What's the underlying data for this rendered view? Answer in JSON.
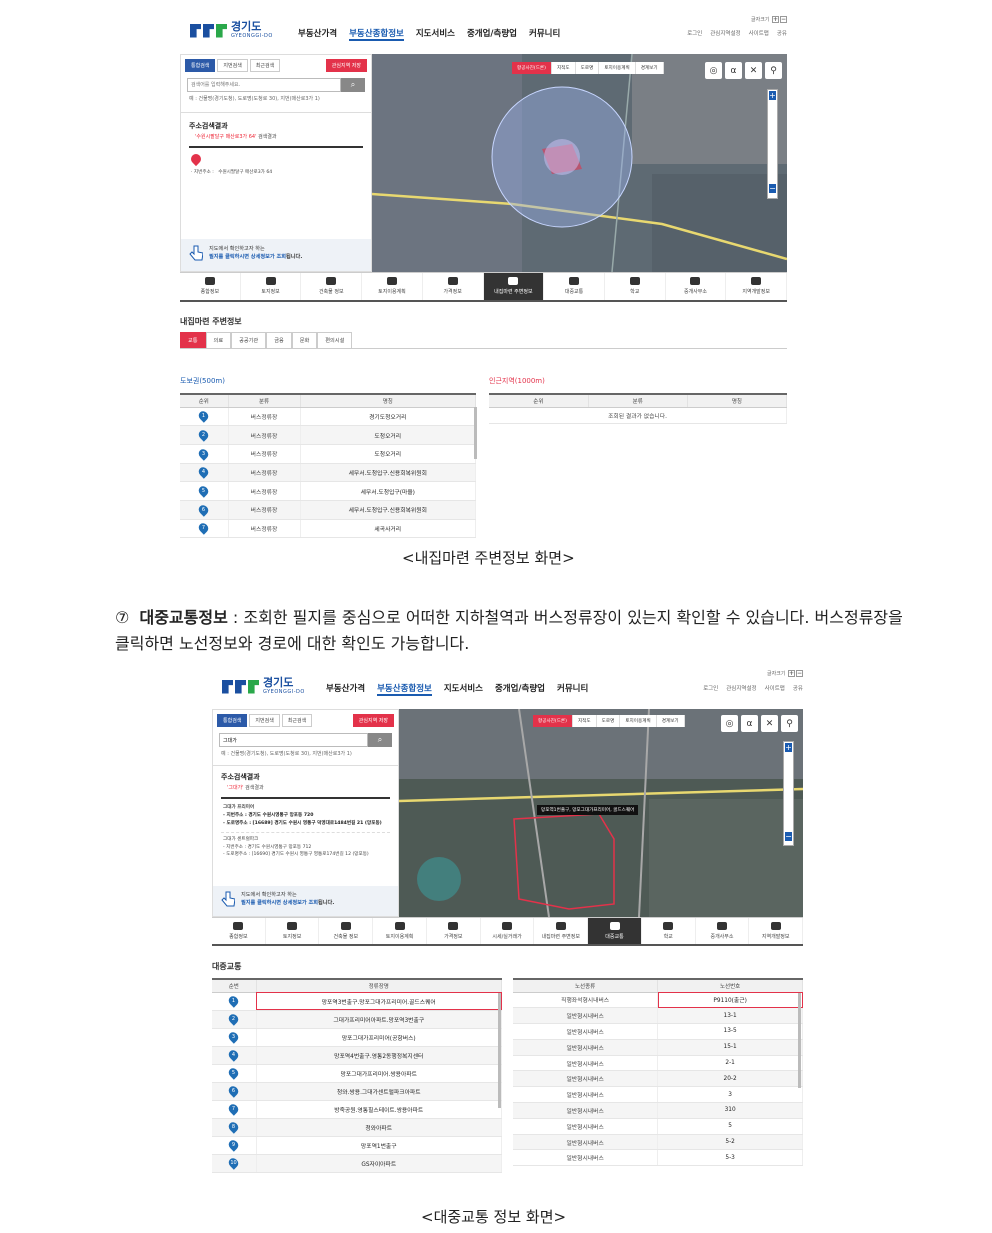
{
  "shot1": {
    "logo": {
      "name": "경기도",
      "sub": "GYEONGGI-DO"
    },
    "gnb": [
      "부동산가격",
      "부동산종합정보",
      "지도서비스",
      "중개업/측량업",
      "커뮤니티"
    ],
    "gnb_active_index": 1,
    "font_size_label": "글자크기",
    "util": [
      "로그인",
      "관심지역설정",
      "사이트맵",
      "공유"
    ],
    "search_tabs": [
      "통합검색",
      "지번검색",
      "최근검색"
    ],
    "favorite_btn": "관심지역 저장",
    "search_placeholder": "검색어를 입력해주세요.",
    "search_hint": "예 : 건물명(경기도청), 도로명(도청로 30), 지번(매산로3가 1)",
    "result_title": "주소검색결과",
    "result_query": "'수원시팔달구 매산로3가 64'",
    "result_count": "검색결과",
    "addr_label": "· 지번주소 :",
    "addr_value": "수원시팔달구 매산로3가 64",
    "click_msg_1": "지도에서 확인하고자 하는",
    "click_msg_2a": "필지를 클릭하시면 상세정보가 조회",
    "click_msg_2b": "됩니다.",
    "map_layers": [
      "항공사진(드론)",
      "지적도",
      "도로명",
      "토지이용계획",
      "경계보기"
    ],
    "categories": [
      "종합정보",
      "토지정보",
      "건축물 정보",
      "토지이용계획",
      "가격정보",
      "내집마련 주변정보",
      "대중교통",
      "학교",
      "중개사무소",
      "지역개발정보"
    ],
    "categories_active_index": 5,
    "section_title": "내집마련 주변정보",
    "sub_tabs": [
      "교통",
      "의료",
      "공공기관",
      "금융",
      "문화",
      "편의시설"
    ],
    "walk_title": "도보권(500m)",
    "near_title": "인근지역(1000m)",
    "table_headers": [
      "순위",
      "분류",
      "명칭"
    ],
    "walk_rows": [
      {
        "rank": "1",
        "type": "버스정류장",
        "name": "경기도청오거리"
      },
      {
        "rank": "2",
        "type": "버스정류장",
        "name": "도청오거리"
      },
      {
        "rank": "3",
        "type": "버스정류장",
        "name": "도청오거리"
      },
      {
        "rank": "4",
        "type": "버스정류장",
        "name": "세무서.도청입구.신용회복위원회"
      },
      {
        "rank": "5",
        "type": "버스정류장",
        "name": "세무서.도청입구(마을)"
      },
      {
        "rank": "6",
        "type": "버스정류장",
        "name": "세무서.도청입구.신용회복위원회"
      },
      {
        "rank": "7",
        "type": "버스정류장",
        "name": "세곡사거리"
      }
    ],
    "near_empty": "조회된 결과가 없습니다."
  },
  "caption1": "<내집마련 주변정보 화면>",
  "paragraph": {
    "marker": "⑦",
    "title": "대중교통정보",
    "text": " : 조회한 필지를 중심으로 어떠한 지하철역과 버스정류장이 있는지 확인할 수 있습니다. 버스정류장을 클릭하면 노선정보와 경로에 대한 확인도 가능합니다."
  },
  "shot2": {
    "search_value": "그대가",
    "result_query": "'그대가'",
    "result_count": "검색결과",
    "item1_title": "그대가 프리미어",
    "item1_addr1_label": "- 지번주소 :",
    "item1_addr1": "경기도 수원시영통구 망포동 720",
    "item1_addr2_label": "- 도로명주소 :",
    "item1_addr2": "[16689] 경기도 수원시 영통구 덕영대로1484번길 21 (망포동)",
    "item2_title": "그대가 센트럴파크",
    "item2_addr1": "- 지번주소 :  경기도 수원시영통구 망포동 712",
    "item2_addr2": "- 도로명주소 :  [16690] 경기도 수원시 영통구 영통로174번길 12 (망포동)",
    "map_label": "망포역1번출구, 망포그대가프리미어, 골드스퀘어",
    "categories": [
      "종합정보",
      "토지정보",
      "건축물 정보",
      "토지이용계획",
      "가격정보",
      "시세/실거래가",
      "내집마련 주변정보",
      "대중교통",
      "학교",
      "중개사무소",
      "지역개발정보"
    ],
    "categories_active_index": 7,
    "section_title": "대중교통",
    "left_headers": [
      "순번",
      "정류장명"
    ],
    "stops": [
      {
        "no": "1",
        "name": "망포역3번출구.망포그대가프리미어.골드스퀘어"
      },
      {
        "no": "2",
        "name": "그대가프리미어아파트.망포역3번출구"
      },
      {
        "no": "3",
        "name": "망포그대가프리미어(공항버스)"
      },
      {
        "no": "4",
        "name": "망포역4번출구.영통2동행정복지센터"
      },
      {
        "no": "5",
        "name": "망포그대가프리미어.쌍용아파트"
      },
      {
        "no": "6",
        "name": "청와.쌍용.그대가센트럴파크아파트"
      },
      {
        "no": "7",
        "name": "방죽공원.영통힐스테이트.쌍용아파트"
      },
      {
        "no": "8",
        "name": "청와아파트"
      },
      {
        "no": "9",
        "name": "망포역1번출구"
      },
      {
        "no": "10",
        "name": "GS자이아파트"
      }
    ],
    "right_headers": [
      "노선종류",
      "노선번호"
    ],
    "routes": [
      {
        "kind": "직행좌석형시내버스",
        "no": "P9110(출근)"
      },
      {
        "kind": "일반형시내버스",
        "no": "13-1"
      },
      {
        "kind": "일반형시내버스",
        "no": "13-5"
      },
      {
        "kind": "일반형시내버스",
        "no": "15-1"
      },
      {
        "kind": "일반형시내버스",
        "no": "2-1"
      },
      {
        "kind": "일반형시내버스",
        "no": "20-2"
      },
      {
        "kind": "일반형시내버스",
        "no": "3"
      },
      {
        "kind": "일반형시내버스",
        "no": "310"
      },
      {
        "kind": "일반형시내버스",
        "no": "5"
      },
      {
        "kind": "일반형시내버스",
        "no": "5-2"
      },
      {
        "kind": "일반형시내버스",
        "no": "5-3"
      }
    ]
  },
  "caption2": "<대중교통 정보 화면>"
}
